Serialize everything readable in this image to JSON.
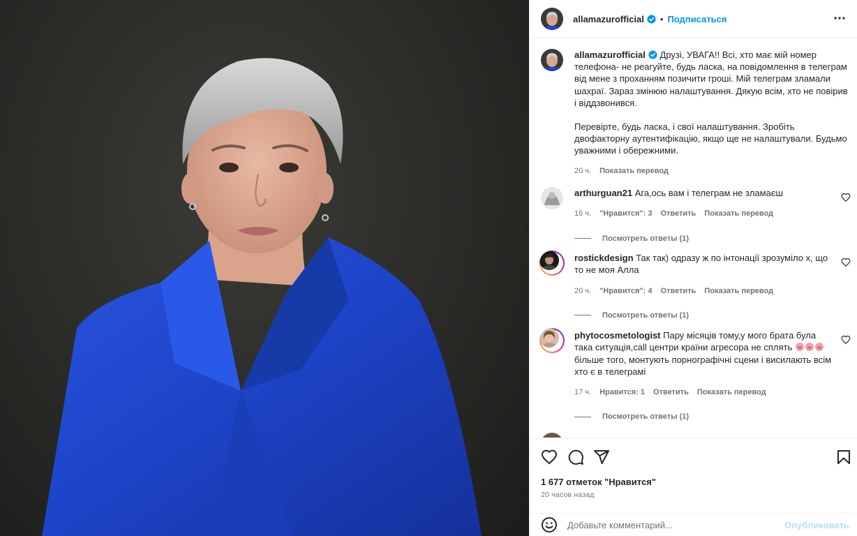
{
  "post": {
    "author": "allamazurofficial",
    "follow_label": "Подписаться",
    "separator": "•",
    "caption_p1": "Друзі, УВАГА!! Всі, хто має мій номер телефона- не реагуйте, будь ласка, на повідомлення в телеграм від мене з проханням позичити гроші. Мій телеграм зламали шахраї. Зараз змінюю налаштування. Дякую всім, хто не повірив і віддзвонився.",
    "caption_p2": "Перевірте, будь ласка, і свої налаштування. Зробіть двофакторну аутентифікацію, якщо ще не налаштували. Будьмо уважними і обережними.",
    "caption_time": "20 ч.",
    "translate_label": "Показать перевод",
    "likes": "1 677 отметок \"Нравится\"",
    "posted_ago": "20 часов назад"
  },
  "comments": [
    {
      "user": "arthurguan21",
      "text": "Ага,ось вам і телеграм не зламаєш",
      "time": "16 ч.",
      "likes": "\"Нравится\": 3",
      "reply": "Ответить",
      "translate": "Показать перевод",
      "replies": "Посмотреть ответы (1)"
    },
    {
      "user": "rostickdesign",
      "text": "Так так) одразу ж по інтонації зрозуміло х, що то не моя Алла",
      "time": "20 ч.",
      "likes": "\"Нравится\": 4",
      "reply": "Ответить",
      "translate": "Показать перевод",
      "replies": "Посмотреть ответы (1)"
    },
    {
      "user": "phytocosmetologist",
      "text_a": "Пару місяців тому,у мого брата була така ситуація,call центри країни агресора не сплять",
      "text_b": "більше того, монтують порнографічні сцени і висилають всім хто є в телеграмі",
      "emoji": "pig-face-emoji",
      "time": "17 ч.",
      "likes": "Нравится: 1",
      "reply": "Ответить",
      "translate": "Показать перевод",
      "replies": "Посмотреть ответы (1)"
    }
  ],
  "composer": {
    "placeholder": "Добавьте комментарий...",
    "publish_label": "Опубликовать"
  },
  "colors": {
    "accent": "#0095f6",
    "publish_disabled": "#b2dffc",
    "muted": "#737373",
    "jacket_blue": "#1f46c9"
  },
  "icons": [
    "verified-badge-icon",
    "more-options-icon",
    "heart-icon",
    "comment-icon",
    "share-icon",
    "bookmark-icon",
    "emoji-icon"
  ]
}
